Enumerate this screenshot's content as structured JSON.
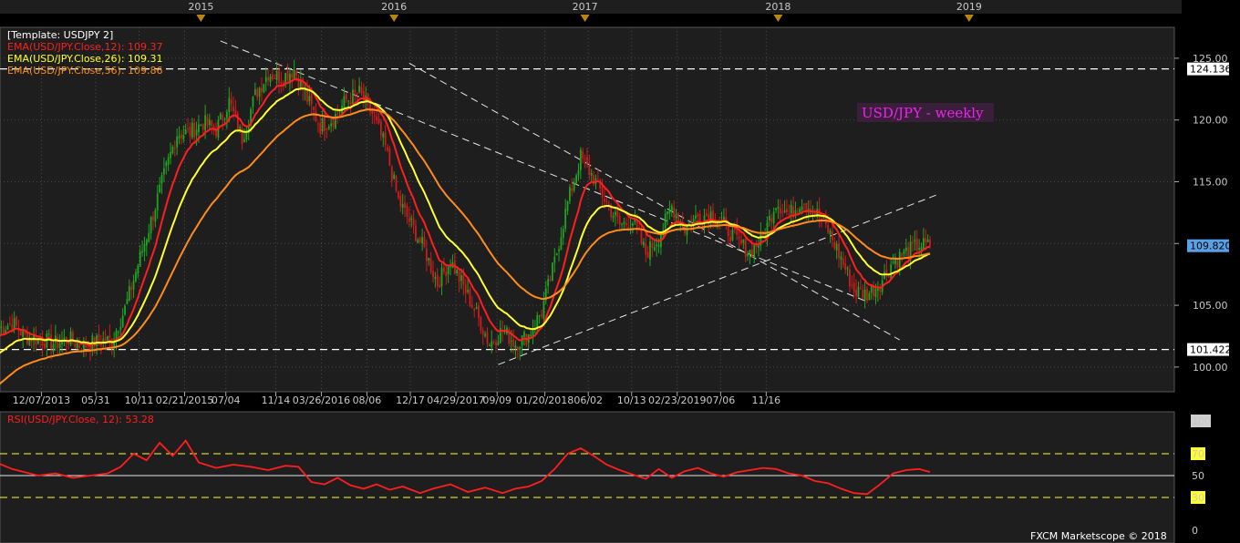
{
  "template_label": "[Template: USDJPY 2]",
  "watermark_title": "USD/JPY - weekly",
  "credit": "FXCM Marketscope © 2018",
  "colors": {
    "background": "#000000",
    "panel": "#1e1e1e",
    "grid": "#4a4a4a",
    "bull": "#1fa51f",
    "bear": "#d11a1a",
    "ema12": "#ff1e1e",
    "ema26": "#ffff30",
    "ema56": "#ff8c1a",
    "rsi": "#ff1e1e",
    "rsi_levels": "#ffff30",
    "hline": "#ffffff",
    "title": "#ee22ee",
    "price_box": "#ffffff",
    "current_box": "#5aa0e6",
    "timeline_marker": "#b8860b"
  },
  "timeline": {
    "years": [
      "2015",
      "2016",
      "2017",
      "2018",
      "2019"
    ]
  },
  "chart_data": [
    {
      "type": "candlestick",
      "title": "USD/JPY - weekly",
      "x_tick_labels": [
        "12/07/2013",
        "05/31",
        "10/11",
        "02/21/2015",
        "07/04",
        "11/14",
        "03/26/2016",
        "08/06",
        "12/17",
        "04/29/2017",
        "09/09",
        "01/20/2018",
        "06/02",
        "10/13",
        "02/23/2019",
        "07/06",
        "11/16"
      ],
      "y_ticks": [
        100.0,
        105.0,
        110.0,
        115.0,
        120.0,
        125.0
      ],
      "y_tick_labels": [
        "100.00",
        "105.00",
        "110.00",
        "115.00",
        "120.00",
        "125.00"
      ],
      "ylim": [
        98.0,
        127.5
      ],
      "grid": true,
      "legend": [
        {
          "label": "EMA(USD/JPY.Close,12):",
          "value": "109.37",
          "color_key": "ema12"
        },
        {
          "label": "EMA(USD/JPY.Close,26):",
          "value": "109.31",
          "color_key": "ema26"
        },
        {
          "label": "EMA(USD/JPY.Close,56):",
          "value": "109.86",
          "color_key": "ema56"
        }
      ],
      "horizontal_levels": [
        {
          "value": 124.136,
          "label": "124.136"
        },
        {
          "value": 101.422,
          "label": "101.422"
        }
      ],
      "current_price": {
        "value": 109.82,
        "label": "109.820"
      },
      "price_anchors": [
        [
          0,
          103.1
        ],
        [
          6,
          103.6
        ],
        [
          12,
          102.5
        ],
        [
          20,
          102.2
        ],
        [
          26,
          101.9
        ],
        [
          32,
          102.3
        ],
        [
          38,
          101.7
        ],
        [
          44,
          102.0
        ],
        [
          52,
          102.2
        ],
        [
          58,
          104.7
        ],
        [
          64,
          108.3
        ],
        [
          70,
          111.8
        ],
        [
          76,
          115.5
        ],
        [
          82,
          118.9
        ],
        [
          88,
          119.0
        ],
        [
          94,
          119.8
        ],
        [
          100,
          119.2
        ],
        [
          106,
          121.5
        ],
        [
          112,
          118.5
        ],
        [
          118,
          122.0
        ],
        [
          124,
          123.8
        ],
        [
          130,
          123.4
        ],
        [
          136,
          124.1
        ],
        [
          142,
          121.7
        ],
        [
          148,
          119.5
        ],
        [
          154,
          120.1
        ],
        [
          160,
          121.6
        ],
        [
          166,
          122.2
        ],
        [
          172,
          120.5
        ],
        [
          178,
          117.8
        ],
        [
          184,
          113.5
        ],
        [
          190,
          111.5
        ],
        [
          196,
          109.5
        ],
        [
          202,
          106.8
        ],
        [
          208,
          108.6
        ],
        [
          214,
          106.5
        ],
        [
          220,
          104.3
        ],
        [
          226,
          101.9
        ],
        [
          232,
          103.0
        ],
        [
          238,
          101.9
        ],
        [
          244,
          102.6
        ],
        [
          250,
          104.5
        ],
        [
          256,
          108.5
        ],
        [
          262,
          113.3
        ],
        [
          268,
          117.0
        ],
        [
          274,
          115.3
        ],
        [
          280,
          113.3
        ],
        [
          286,
          111.5
        ],
        [
          292,
          111.8
        ],
        [
          298,
          109.2
        ],
        [
          304,
          110.5
        ],
        [
          310,
          113.0
        ],
        [
          316,
          111.2
        ],
        [
          322,
          112.2
        ],
        [
          328,
          112.4
        ],
        [
          334,
          111.5
        ],
        [
          340,
          110.2
        ],
        [
          346,
          109.3
        ],
        [
          352,
          110.5
        ],
        [
          358,
          113.4
        ],
        [
          364,
          112.3
        ],
        [
          370,
          113.5
        ],
        [
          376,
          112.6
        ],
        [
          382,
          111.1
        ],
        [
          388,
          108.8
        ],
        [
          394,
          106.2
        ],
        [
          400,
          105.9
        ],
        [
          406,
          106.8
        ],
        [
          412,
          108.6
        ],
        [
          418,
          109.3
        ],
        [
          424,
          109.9
        ],
        [
          429,
          109.8
        ]
      ],
      "trend_lines": [
        {
          "from": {
            "week": 102,
            "price": 126.4
          },
          "to": {
            "week": 400,
            "price": 105.3
          },
          "style": "dashed"
        },
        {
          "from": {
            "week": 189,
            "price": 124.6
          },
          "to": {
            "week": 415,
            "price": 102.2
          },
          "style": "dashed"
        },
        {
          "from": {
            "week": 230,
            "price": 100.2
          },
          "to": {
            "week": 433,
            "price": 114.0
          },
          "style": "dashed"
        }
      ],
      "series": [
        {
          "name": "EMA(USD/JPY.Close,12)",
          "period": 12,
          "color_key": "ema12"
        },
        {
          "name": "EMA(USD/JPY.Close,26)",
          "period": 26,
          "color_key": "ema26"
        },
        {
          "name": "EMA(USD/JPY.Close,56)",
          "period": 56,
          "color_key": "ema56"
        }
      ]
    },
    {
      "type": "line",
      "title": "RSI(USD/JPY.Close, 12): 53.28",
      "name": "RSI(USD/JPY.Close, 12)",
      "value": 53.28,
      "ylim": [
        0,
        100
      ],
      "y_tick_labels": [
        "100",
        "70",
        "50",
        "30",
        "0"
      ],
      "levels": [
        70,
        50,
        30
      ],
      "level_labels": [
        "70",
        "50",
        "30"
      ],
      "values": [
        [
          0,
          61
        ],
        [
          6,
          56
        ],
        [
          12,
          53
        ],
        [
          18,
          50
        ],
        [
          26,
          52
        ],
        [
          34,
          48
        ],
        [
          42,
          50
        ],
        [
          50,
          52
        ],
        [
          56,
          58
        ],
        [
          62,
          70
        ],
        [
          68,
          64
        ],
        [
          74,
          80
        ],
        [
          80,
          68
        ],
        [
          86,
          82
        ],
        [
          92,
          62
        ],
        [
          100,
          57
        ],
        [
          108,
          60
        ],
        [
          116,
          58
        ],
        [
          124,
          55
        ],
        [
          132,
          59
        ],
        [
          138,
          58
        ],
        [
          144,
          44
        ],
        [
          150,
          42
        ],
        [
          156,
          48
        ],
        [
          162,
          41
        ],
        [
          168,
          38
        ],
        [
          174,
          42
        ],
        [
          180,
          37
        ],
        [
          186,
          40
        ],
        [
          194,
          34
        ],
        [
          200,
          38
        ],
        [
          208,
          42
        ],
        [
          216,
          35
        ],
        [
          224,
          39
        ],
        [
          232,
          34
        ],
        [
          238,
          38
        ],
        [
          244,
          40
        ],
        [
          250,
          45
        ],
        [
          256,
          56
        ],
        [
          262,
          70
        ],
        [
          268,
          75
        ],
        [
          274,
          68
        ],
        [
          280,
          60
        ],
        [
          286,
          55
        ],
        [
          292,
          51
        ],
        [
          298,
          47
        ],
        [
          304,
          56
        ],
        [
          310,
          48
        ],
        [
          316,
          54
        ],
        [
          322,
          57
        ],
        [
          328,
          52
        ],
        [
          334,
          49
        ],
        [
          340,
          53
        ],
        [
          346,
          55
        ],
        [
          352,
          57
        ],
        [
          358,
          56
        ],
        [
          364,
          52
        ],
        [
          370,
          50
        ],
        [
          376,
          45
        ],
        [
          382,
          43
        ],
        [
          388,
          38
        ],
        [
          394,
          34
        ],
        [
          400,
          33
        ],
        [
          406,
          42
        ],
        [
          412,
          52
        ],
        [
          418,
          55
        ],
        [
          424,
          56
        ],
        [
          429,
          53.28
        ]
      ]
    }
  ]
}
